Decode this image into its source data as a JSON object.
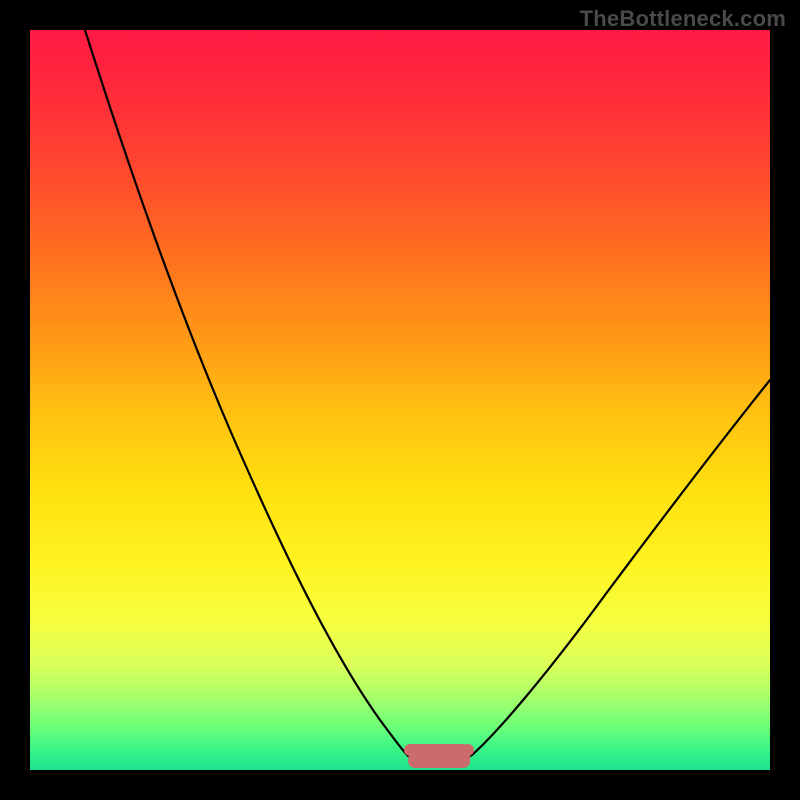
{
  "watermark": "TheBottleneck.com",
  "colors": {
    "curve": "#000000",
    "blob": "#cc6b6b",
    "gradient_top": "#ff1a44",
    "gradient_bottom": "#1de28e",
    "background": "#000000"
  },
  "chart_data": {
    "type": "line",
    "title": "",
    "xlabel": "",
    "ylabel": "",
    "xlim": [
      0,
      100
    ],
    "ylim": [
      0,
      100
    ],
    "grid": false,
    "legend": false,
    "series": [
      {
        "name": "bottleneck-curve",
        "x": [
          0,
          5,
          10,
          15,
          20,
          25,
          30,
          35,
          40,
          45,
          48,
          50,
          52,
          55,
          58,
          60,
          65,
          70,
          75,
          80,
          85,
          90,
          95,
          100
        ],
        "y": [
          100,
          90,
          80,
          70,
          60,
          50,
          40,
          30,
          20,
          10,
          4,
          1,
          0.5,
          0.5,
          1,
          4,
          12,
          20,
          28,
          36,
          44,
          50,
          55,
          58
        ]
      }
    ],
    "annotations": [
      {
        "name": "optimal-zone-blob",
        "x_range": [
          50,
          58
        ],
        "y": 0.5,
        "shape": "flat-blob"
      }
    ]
  }
}
